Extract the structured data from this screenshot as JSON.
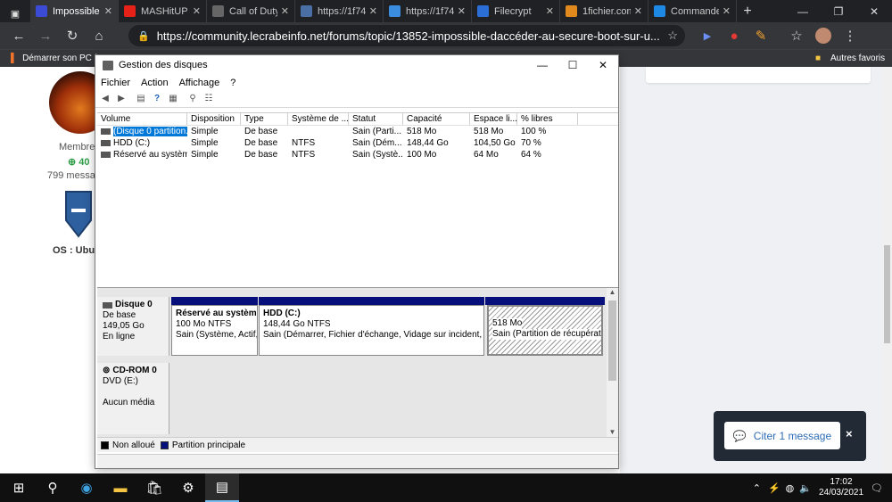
{
  "browser": {
    "tabs": [
      {
        "label": "Impossible",
        "favicon": "site-icon",
        "color": "#3b4bd6",
        "active": true
      },
      {
        "label": "MASHitUP",
        "favicon": "youtube-icon",
        "color": "#e62117",
        "active": false
      },
      {
        "label": "Call of Duty",
        "favicon": "blank-page-icon",
        "color": "#666666",
        "active": false
      },
      {
        "label": "https://1f74",
        "favicon": "u-icon",
        "color": "#4a6fa5",
        "active": false
      },
      {
        "label": "https://1f74",
        "favicon": "u-icon",
        "color": "#3b8de0",
        "active": false
      },
      {
        "label": "Filecrypt",
        "favicon": "shield-icon",
        "color": "#2b6fd6",
        "active": false
      },
      {
        "label": "1fichier.com",
        "favicon": "fichier-icon",
        "color": "#e08a1e",
        "active": false
      },
      {
        "label": "Commande",
        "favicon": "g-icon",
        "color": "#1e88e5",
        "active": false
      }
    ],
    "new_tab_label": "+",
    "url": "https://community.lecrabeinfo.net/forums/topic/13852-impossible-daccéder-au-secure-boot-sur-u...",
    "bookmarks": {
      "left": "Démarrer son PC à",
      "right": "Autres favoris"
    }
  },
  "profile": {
    "role": "Membre",
    "reputation": "40",
    "messages": "799 messa",
    "os_label": "OS : Ubu"
  },
  "quote_button": {
    "label": "Citer 1 message",
    "close": "×"
  },
  "disk_mgmt": {
    "title": "Gestion des disques",
    "menu": [
      "Fichier",
      "Action",
      "Affichage",
      "?"
    ],
    "columns": [
      "Volume",
      "Disposition",
      "Type",
      "Système de ...",
      "Statut",
      "Capacité",
      "Espace li...",
      "% libres"
    ],
    "rows": [
      [
        "(Disque 0 partition...",
        "Simple",
        "De base",
        "",
        "Sain (Parti...",
        "518 Mo",
        "518 Mo",
        "100 %"
      ],
      [
        "HDD (C:)",
        "Simple",
        "De base",
        "NTFS",
        "Sain (Dém...",
        "148,44 Go",
        "104,50 Go",
        "70 %"
      ],
      [
        "Réservé au système",
        "Simple",
        "De base",
        "NTFS",
        "Sain (Systè...",
        "100 Mo",
        "64 Mo",
        "64 %"
      ]
    ],
    "disks": [
      {
        "name": "Disque 0",
        "type": "De base",
        "size": "149,05 Go",
        "state": "En ligne",
        "partitions": [
          {
            "name": "Réservé au système",
            "size": "100 Mo NTFS",
            "status": "Sain (Système, Actif,"
          },
          {
            "name": "HDD  (C:)",
            "size": "148,44 Go NTFS",
            "status": "Sain (Démarrer, Fichier d'échange, Vidage sur incident, Part"
          },
          {
            "name": "",
            "size": "518 Mo",
            "status": "Sain (Partition de récupération"
          }
        ]
      },
      {
        "name": "CD-ROM 0",
        "type": "DVD (E:)",
        "size": "",
        "state": "Aucun média",
        "partitions": []
      }
    ],
    "legend": [
      {
        "label": "Non alloué",
        "color": "#000000"
      },
      {
        "label": "Partition principale",
        "color": "#07107a"
      }
    ]
  },
  "taskbar": {
    "time": "17:02",
    "date": "24/03/2021"
  },
  "colors": {
    "browser_dark": "#202124",
    "partition_header": "#07107a",
    "selection": "#0078d7",
    "quote_bg": "#222a36",
    "reputation_green": "#2e9e47"
  }
}
